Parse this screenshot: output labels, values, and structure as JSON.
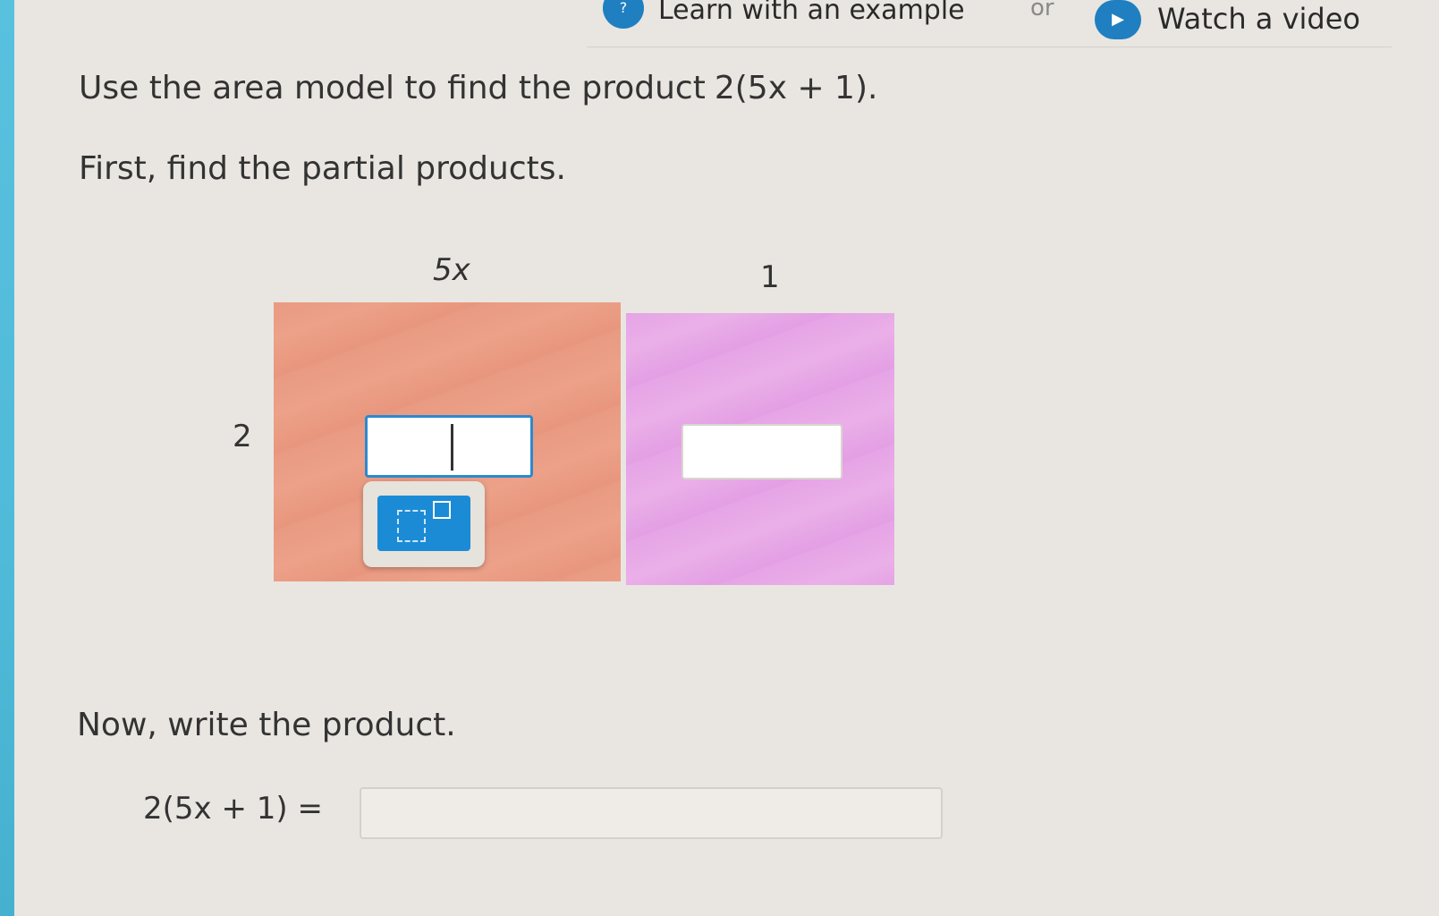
{
  "header": {
    "learn_icon": "info-icon",
    "learn_label": "Learn with an example",
    "or_label": "or",
    "video_icon": "play-icon",
    "video_label": "Watch a video"
  },
  "problem": {
    "prompt": "Use the area model to find the product",
    "expression": "2(5x + 1).",
    "step1": "First, find the partial products.",
    "step2": "Now, write the product."
  },
  "area_model": {
    "col_1_label": "5x",
    "col_2_label": "1",
    "row_label": "2",
    "cell_1_value": "",
    "cell_2_value": "",
    "cell_1_color": "#e99a82",
    "cell_2_color": "#e6a4e6",
    "toolbar_button": "exponent-template-icon"
  },
  "final_answer": {
    "lhs": "2(5x + 1) =",
    "value": ""
  },
  "colors": {
    "accent": "#1f7fc0",
    "left_bar": "#58c1de",
    "input_focus": "#2a8ad0"
  }
}
